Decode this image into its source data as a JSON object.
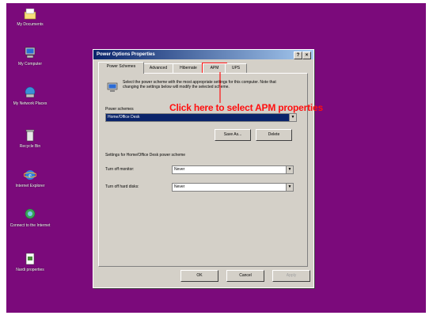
{
  "desktop": {
    "icons": [
      {
        "label": "My Documents",
        "icon": "folder-icon"
      },
      {
        "label": "My Computer",
        "icon": "computer-icon"
      },
      {
        "label": "My Network Places",
        "icon": "network-icon"
      },
      {
        "label": "Recycle Bin",
        "icon": "recycle-bin-icon"
      },
      {
        "label": "Internet Explorer",
        "icon": "internet-explorer-icon"
      },
      {
        "label": "Connect to the Internet",
        "icon": "connect-internet-icon"
      },
      {
        "label": "Nardi properties",
        "icon": "document-icon"
      }
    ],
    "background_color": "#7b0a7b"
  },
  "dialog": {
    "title": "Power Options Properties",
    "title_buttons": [
      "?",
      "×"
    ],
    "tabs": [
      "Power Schemes",
      "Advanced",
      "Hibernate",
      "APM",
      "UPS"
    ],
    "selected_tab": "Power Schemes",
    "description": "Select the power scheme with the most appropriate settings for this computer. Note that changing the settings below will modify the selected scheme.",
    "scheme_label": "Power schemes",
    "scheme_value": "Home/Office Desk",
    "save_as_label": "Save As...",
    "delete_label": "Delete",
    "settings_label": "Settings for Home/Office Desk power scheme",
    "monitor_label": "Turn off monitor:",
    "monitor_value": "Never",
    "disks_label": "Turn off hard disks:",
    "disks_value": "Never",
    "ok_label": "OK",
    "cancel_label": "Cancel",
    "apply_label": "Apply"
  },
  "annotation": {
    "text": "Click here to select APM properties",
    "color": "#ff1010"
  }
}
